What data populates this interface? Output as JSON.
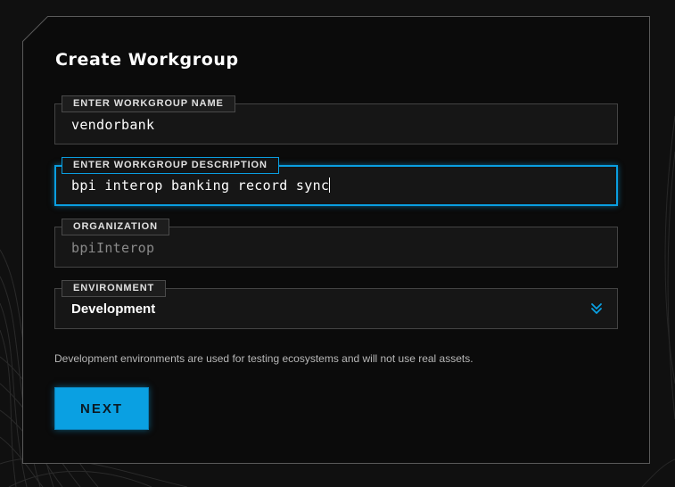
{
  "dialog": {
    "title": "Create Workgroup"
  },
  "form": {
    "name": {
      "label": "ENTER WORKGROUP NAME",
      "value": "vendorbank"
    },
    "description": {
      "label": "ENTER WORKGROUP DESCRIPTION",
      "value": "bpi interop banking record sync"
    },
    "organization": {
      "label": "ORGANIZATION",
      "value": "bpiInterop"
    },
    "environment": {
      "label": "ENVIRONMENT",
      "selected": "Development",
      "icon": "chevron-double-down-icon"
    },
    "hint": "Development environments are used for testing ecosystems and will not use real assets."
  },
  "actions": {
    "next_label": "NEXT"
  },
  "colors": {
    "accent": "#0aa0e2",
    "background": "#0b0b0b",
    "field_background": "#161616",
    "border": "#444444"
  }
}
